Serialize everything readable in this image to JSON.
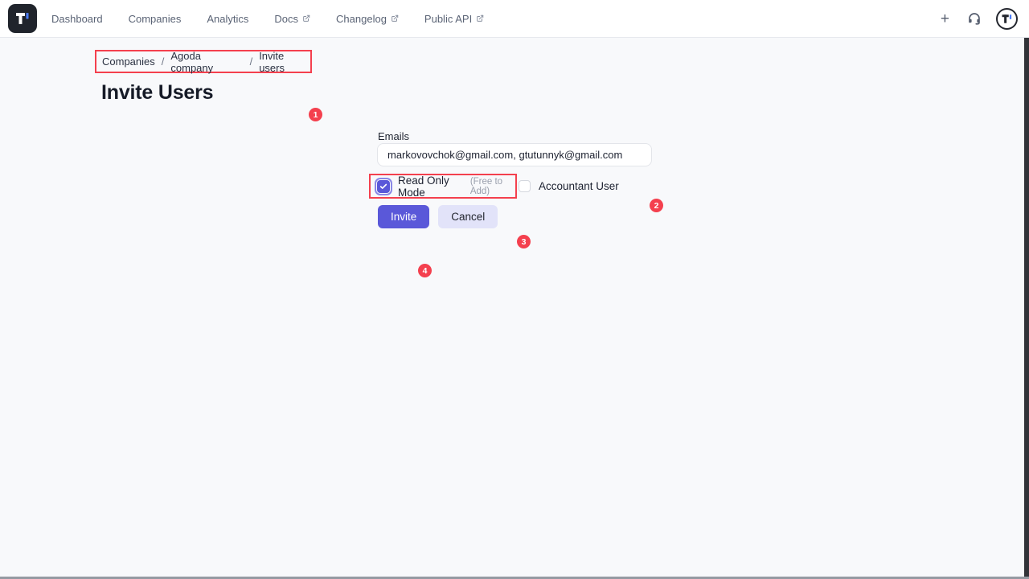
{
  "navbar": {
    "items": [
      {
        "label": "Dashboard",
        "external": false
      },
      {
        "label": "Companies",
        "external": false
      },
      {
        "label": "Analytics",
        "external": false
      },
      {
        "label": "Docs",
        "external": true
      },
      {
        "label": "Changelog",
        "external": true
      },
      {
        "label": "Public API",
        "external": true
      }
    ],
    "plus_label": "+"
  },
  "breadcrumb": {
    "separator": "/",
    "items": [
      "Companies",
      "Agoda company",
      "Invite users"
    ]
  },
  "page": {
    "title": "Invite Users"
  },
  "form": {
    "emails_label": "Emails",
    "emails_value": "markovovchok@gmail.com, gtutunnyk@gmail.com",
    "read_only": {
      "label": "Read Only Mode",
      "hint": "(Free to Add)",
      "checked": true
    },
    "accountant": {
      "label": "Accountant User",
      "checked": false
    },
    "invite_label": "Invite",
    "cancel_label": "Cancel"
  },
  "annotations": {
    "breadcrumb_badge": "1",
    "emails_badge": "2",
    "read_only_badge": "3",
    "invite_badge": "4"
  },
  "colors": {
    "accent": "#5a58d9",
    "accent_light": "#e2e3f9",
    "annotation_red": "#f4404e",
    "navbar_bg": "#ffffff",
    "page_bg": "#f8f9fb"
  }
}
